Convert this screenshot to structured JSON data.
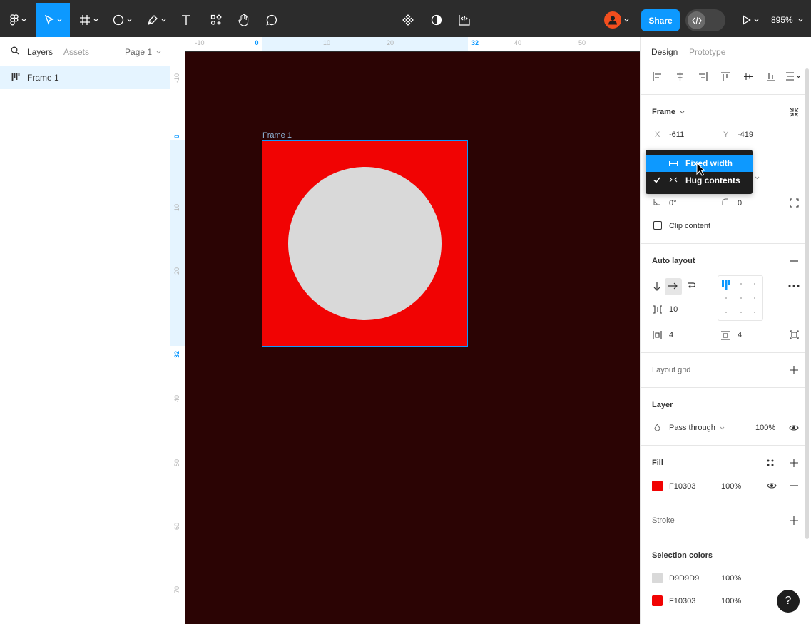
{
  "toolbar": {
    "share_label": "Share",
    "zoom_label": "895%"
  },
  "left_panel": {
    "tabs": [
      "Layers",
      "Assets"
    ],
    "page_select": "Page 1",
    "layers": [
      {
        "name": "Frame 1",
        "icon": "auto-layout-frame-icon"
      }
    ]
  },
  "ruler": {
    "top_ticks": [
      "-10",
      "0",
      "10",
      "20",
      "32",
      "40",
      "50"
    ],
    "left_ticks": [
      "-10",
      "0",
      "10",
      "20",
      "32",
      "40",
      "50",
      "60",
      "70"
    ]
  },
  "canvas": {
    "frame_label": "Frame 1",
    "frame_color": "#F10303",
    "ellipse_color": "#D9D9D9",
    "background_color": "#2B0404"
  },
  "right_panel": {
    "tabs": [
      "Design",
      "Prototype"
    ],
    "frame": {
      "title": "Frame",
      "x_label": "X",
      "x_value": "-611",
      "y_label": "Y",
      "y_value": "-419",
      "rotation": "0°",
      "radius": "0",
      "clip_content_label": "Clip content"
    },
    "auto_layout": {
      "title": "Auto layout",
      "gap": "10",
      "padding_h": "4",
      "padding_v": "4"
    },
    "layout_grid": {
      "title": "Layout grid"
    },
    "layer": {
      "title": "Layer",
      "blend_mode": "Pass through",
      "opacity": "100%"
    },
    "fill": {
      "title": "Fill",
      "hex": "F10303",
      "opacity": "100%",
      "color": "#F10303"
    },
    "stroke": {
      "title": "Stroke"
    },
    "selection_colors": {
      "title": "Selection colors",
      "items": [
        {
          "hex": "D9D9D9",
          "opacity": "100%",
          "color": "#D9D9D9"
        },
        {
          "hex": "F10303",
          "opacity": "100%",
          "color": "#F10303"
        }
      ]
    }
  },
  "dropdown": {
    "items": [
      {
        "label": "Fixed width",
        "icon": "fixed-width-icon",
        "highlighted": true,
        "checked": false
      },
      {
        "label": "Hug contents",
        "icon": "hug-contents-icon",
        "highlighted": false,
        "checked": true
      }
    ]
  },
  "help_label": "?"
}
